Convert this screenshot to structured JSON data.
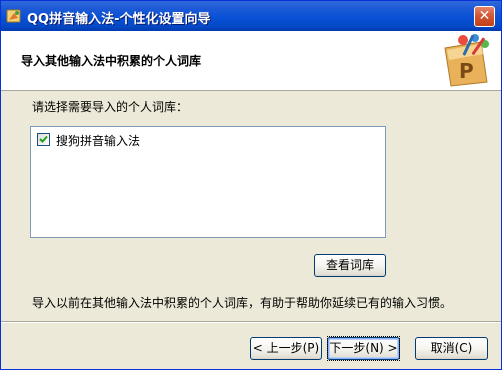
{
  "window": {
    "title": "QQ拼音输入法-个性化设置向导",
    "close_label": "✕"
  },
  "header": {
    "title": "导入其他输入法中积累的个人词库",
    "logo_icon": "qq-pinyin-palette-logo"
  },
  "main": {
    "prompt": "请选择需要导入的个人词库：",
    "list_items": [
      {
        "label": "搜狗拼音输入法",
        "checked": true
      }
    ],
    "view_button": "查看词库",
    "info_text": "导入以前在其他输入法中积累的个人词库，有助于帮助你延续已有的输入习惯。"
  },
  "footer": {
    "back_button": "< 上一步(P)",
    "next_button": "下一步(N) >",
    "cancel_button": "取消(C)"
  },
  "colors": {
    "titlebar": "#0851d5",
    "window_bg": "#ece9d8",
    "list_border": "#7f9db9",
    "button_border": "#003c74"
  }
}
